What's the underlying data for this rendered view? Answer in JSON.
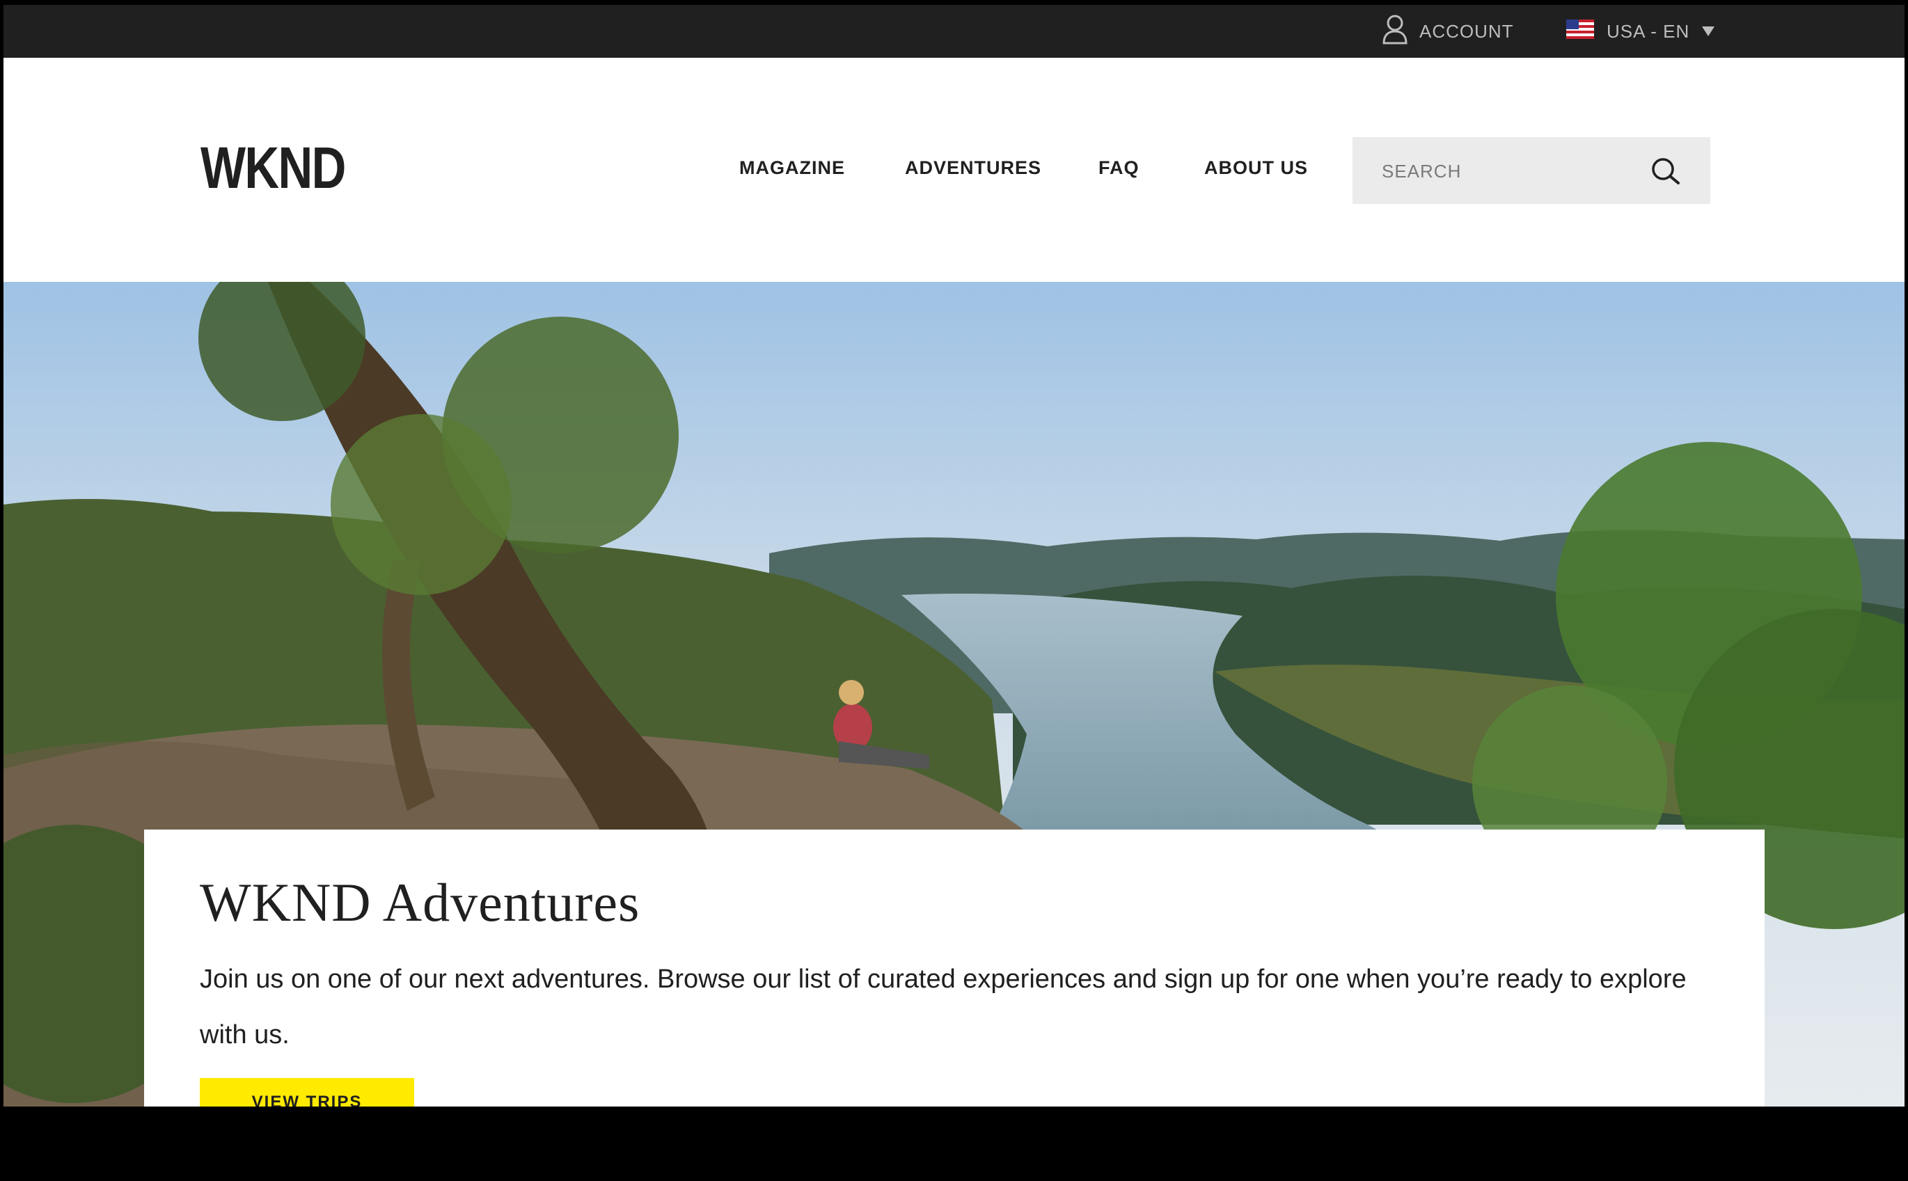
{
  "topbar": {
    "account_label": "ACCOUNT",
    "locale_label": "USA - EN",
    "icons": {
      "account": "user-icon",
      "flag": "us-flag-icon",
      "dropdown": "caret-down-icon"
    }
  },
  "header": {
    "logo": "WKND",
    "nav": [
      {
        "label": "MAGAZINE"
      },
      {
        "label": "ADVENTURES"
      },
      {
        "label": "FAQ"
      },
      {
        "label": "ABOUT US"
      }
    ],
    "search": {
      "placeholder": "SEARCH",
      "value": "",
      "icon": "search-icon"
    }
  },
  "hero": {
    "title": "WKND Adventures",
    "description": "Join us on one of our next adventures. Browse our list of curated experiences and sign up for one when you’re ready to explore with us.",
    "cta_label": "VIEW TRIPS"
  },
  "colors": {
    "topbar": "#202020",
    "accent": "#ffea00",
    "search_bg": "#ebebeb",
    "text": "#202020"
  }
}
